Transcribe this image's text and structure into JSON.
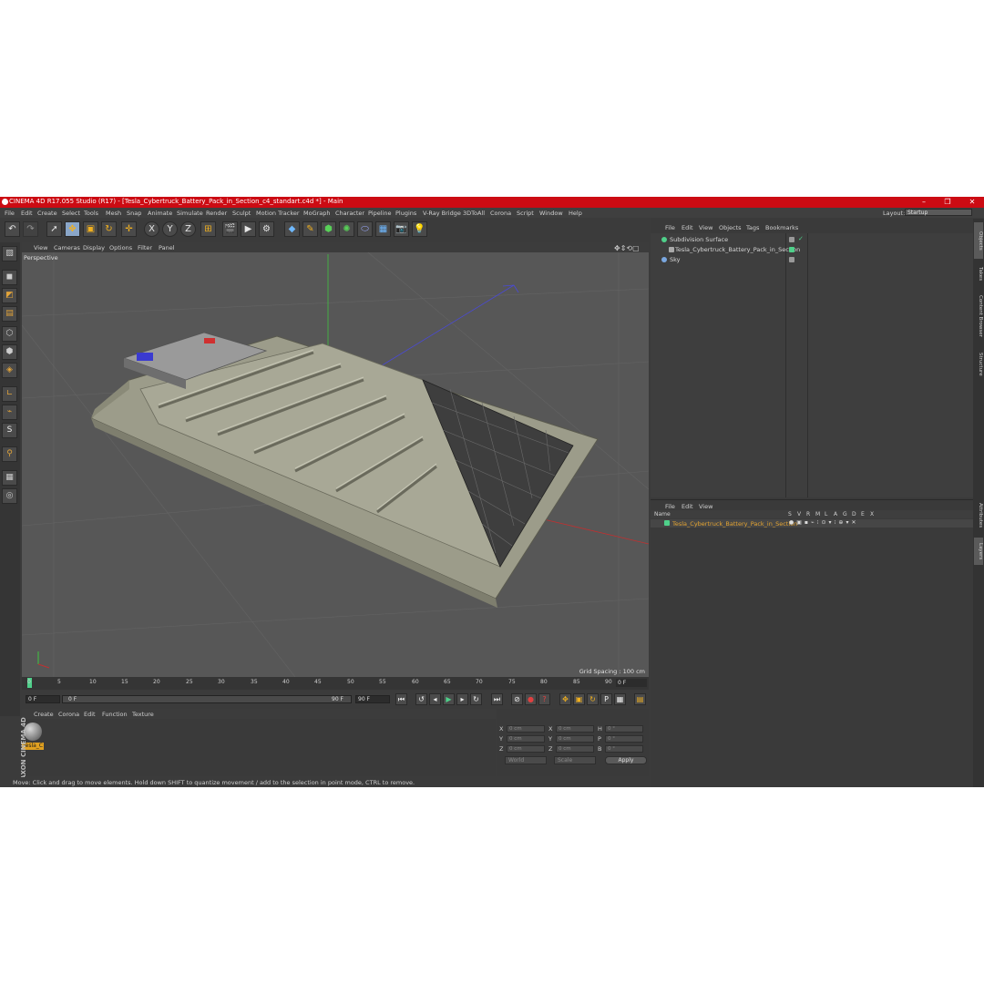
{
  "window": {
    "title": "CINEMA 4D R17.055 Studio (R17) - [Tesla_Cybertruck_Battery_Pack_in_Section_c4_standart.c4d *] - Main",
    "minimize": "–",
    "maximize": "❐",
    "close": "✕"
  },
  "menu": [
    "File",
    "Edit",
    "Create",
    "Select",
    "Tools",
    "Mesh",
    "Snap",
    "Animate",
    "Simulate",
    "Render",
    "Sculpt",
    "Motion Tracker",
    "MoGraph",
    "Character",
    "Pipeline",
    "Plugins",
    "V-Ray Bridge",
    "3DToAll",
    "Corona",
    "Script",
    "Window",
    "Help"
  ],
  "layout": {
    "label": "Layout:",
    "value": "Startup"
  },
  "viewport": {
    "menu": [
      "View",
      "Cameras",
      "Display",
      "Options",
      "Filter",
      "Panel"
    ],
    "label": "Perspective",
    "grid_spacing": "Grid Spacing : 100 cm"
  },
  "timeline": {
    "ticks": [
      "0",
      "5",
      "10",
      "15",
      "20",
      "25",
      "30",
      "35",
      "40",
      "45",
      "50",
      "55",
      "60",
      "65",
      "70",
      "75",
      "80",
      "85",
      "90"
    ],
    "current_frame": "0 F"
  },
  "transport": {
    "start": "0 F",
    "min": "0 F",
    "max": "90 F",
    "end": "90 F"
  },
  "material_manager": {
    "menu": [
      "Create",
      "Corona",
      "Edit",
      "Function",
      "Texture"
    ],
    "material_name": "Tesla_C"
  },
  "coordinates": {
    "rows": [
      {
        "a": "X",
        "av": "0 cm",
        "b": "X",
        "bv": "0 cm",
        "c": "H",
        "cv": "0 °"
      },
      {
        "a": "Y",
        "av": "0 cm",
        "b": "Y",
        "bv": "0 cm",
        "c": "P",
        "cv": "0 °"
      },
      {
        "a": "Z",
        "av": "0 cm",
        "b": "Z",
        "bv": "0 cm",
        "c": "B",
        "cv": "0 °"
      }
    ],
    "mode": "World",
    "scale": "Scale",
    "apply": "Apply"
  },
  "status": "Move: Click and drag to move elements. Hold down SHIFT to quantize movement / add to the selection in point mode, CTRL to remove.",
  "branding": "MAXON CINEMA 4D",
  "object_manager": {
    "menu": [
      "File",
      "Edit",
      "View",
      "Objects",
      "Tags",
      "Bookmarks"
    ],
    "objects": [
      "Subdivision Surface",
      "Tesla_Cybertruck_Battery_Pack_in_Section",
      "Sky"
    ]
  },
  "layer_manager": {
    "menu": [
      "File",
      "Edit",
      "View"
    ],
    "columns": [
      "Name",
      "S",
      "V",
      "R",
      "M",
      "L",
      "A",
      "G",
      "D",
      "E",
      "X"
    ],
    "layer": "Tesla_Cybertruck_Battery_Pack_in_Section"
  },
  "side_tabs": [
    "Objects",
    "Takes",
    "Content Browser",
    "Structure",
    "Attributes",
    "Layers"
  ],
  "colors": {
    "title_red": "#cc0b13",
    "accent_orange": "#e5a431",
    "layer_green": "#4fd08a"
  }
}
